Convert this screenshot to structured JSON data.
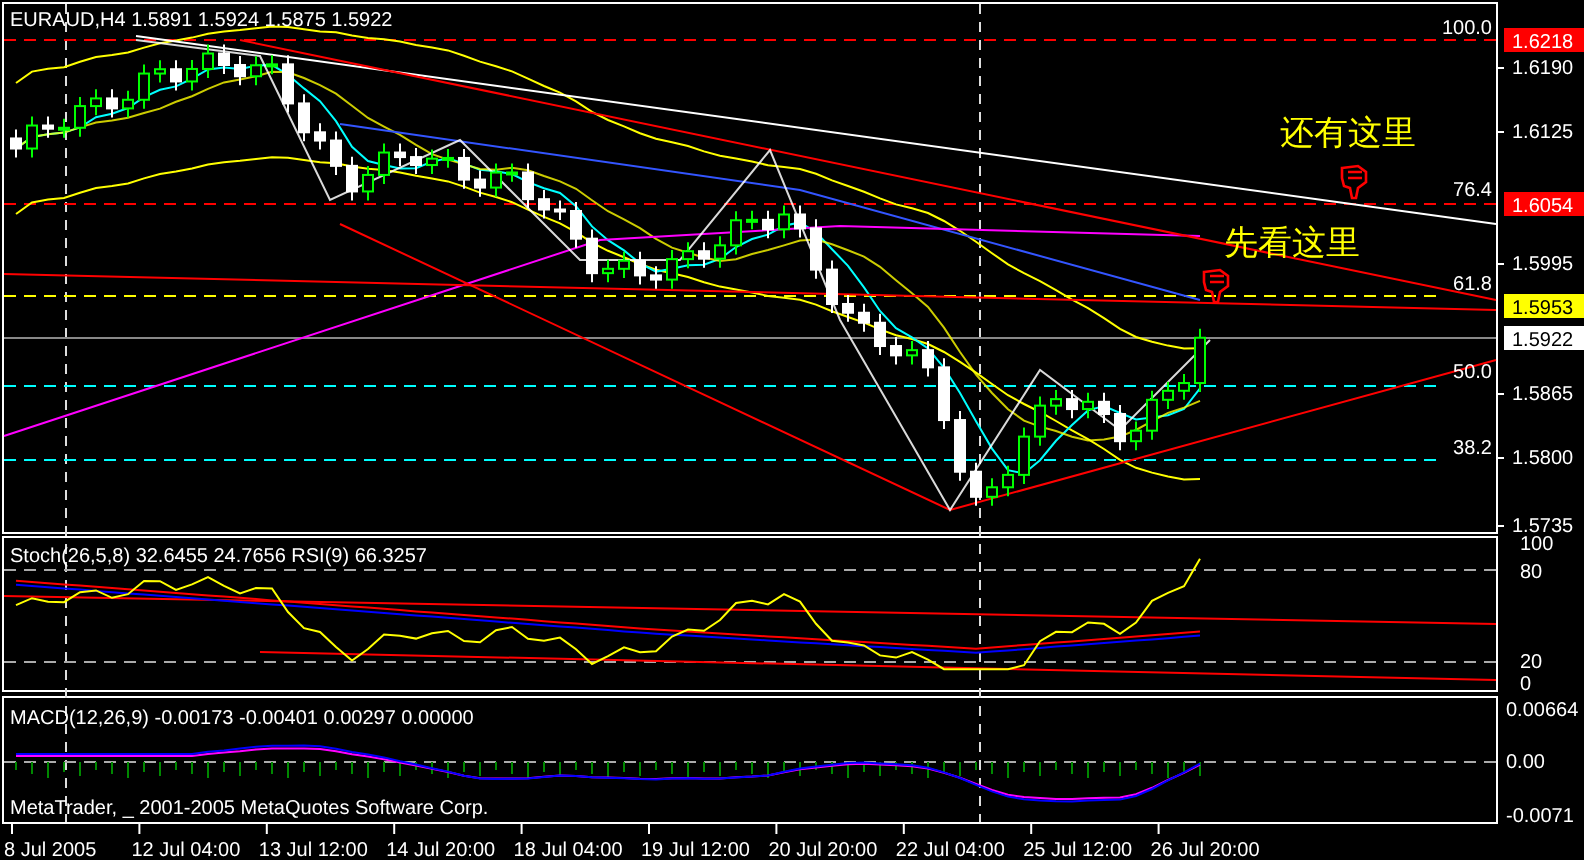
{
  "header": {
    "symbol": "EURAUD,H4",
    "ohlc": "1.5891 1.5924 1.5875 1.5922"
  },
  "price_axis": {
    "ticks": [
      "1.6190",
      "1.6125",
      "1.5995",
      "1.5865",
      "1.5800",
      "1.5735"
    ],
    "markers": [
      {
        "label": "1.6218",
        "color": "#ff0000"
      },
      {
        "label": "1.6054",
        "color": "#ff0000"
      },
      {
        "label": "1.5953",
        "color": "#ffff00"
      },
      {
        "label": "1.5922",
        "color": "#ffffff"
      }
    ]
  },
  "fib_levels": [
    "100.0",
    "76.4",
    "61.8",
    "50.0",
    "38.2"
  ],
  "annotations": [
    "还有这里",
    "先看这里"
  ],
  "stoch_pane": {
    "title": "Stoch(26,5,8) 32.6455 24.7656  RSI(9) 66.3257",
    "axis": [
      "100",
      "80",
      "20",
      "0"
    ]
  },
  "macd_pane": {
    "title": "MACD(12,26,9) -0.00173 -0.00401 0.00297 0.00000",
    "axis": [
      "0.00664",
      "0.00",
      "-0.0071"
    ],
    "copyright": "MetaTrader, _ 2001-2005 MetaQuotes Software Corp."
  },
  "time_axis": [
    "8 Jul 2005",
    "12 Jul 04:00",
    "13 Jul 12:00",
    "14 Jul 20:00",
    "18 Jul 04:00",
    "19 Jul 12:00",
    "20 Jul 20:00",
    "22 Jul 04:00",
    "25 Jul 12:00",
    "26 Jul 20:00"
  ]
}
